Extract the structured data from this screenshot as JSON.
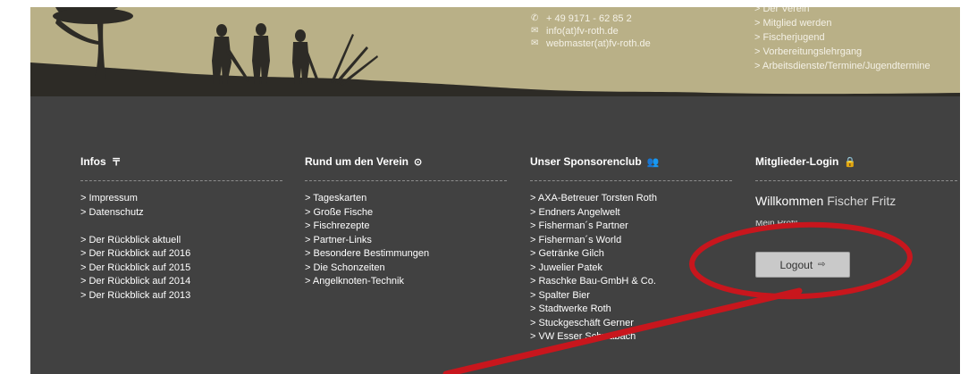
{
  "contact": {
    "phone": "+ 49 9171 - 62 85 2",
    "email1": "info(at)fv-roth.de",
    "email2": "webmaster(at)fv-roth.de"
  },
  "top_links": [
    "> Der Verein",
    "> Mitglied werden",
    "> Fischerjugend",
    "> Vorbereitungslehrgang",
    "> Arbeitsdienste/Termine/Jugendtermine"
  ],
  "columns": {
    "infos": {
      "title": "Infos",
      "items": [
        "> Impressum",
        "> Datenschutz",
        "",
        "> Der Rückblick aktuell",
        "> Der Rückblick auf 2016",
        "> Der Rückblick auf 2015",
        "> Der Rückblick auf 2014",
        "> Der Rückblick auf 2013"
      ]
    },
    "verein": {
      "title": "Rund um den Verein",
      "items": [
        "> Tageskarten",
        "> Große Fische",
        "> Fischrezepte",
        "> Partner-Links",
        "> Besondere Bestimmungen",
        "> Die Schonzeiten",
        "> Angelknoten-Technik"
      ]
    },
    "sponsoren": {
      "title": "Unser Sponsorenclub",
      "items": [
        "> AXA-Betreuer Torsten Roth",
        "> Endners Angelwelt",
        "> Fisherman´s Partner",
        "> Fisherman´s World",
        "> Getränke Gilch",
        "> Juwelier Patek",
        "> Raschke Bau-GmbH & Co.",
        "> Spalter Bier",
        "> Stadtwerke Roth",
        "> Stuckgeschäft Gerner",
        "> VW Esser Schwabach"
      ]
    },
    "login": {
      "title": "Mitglieder-Login",
      "welcome": "Willkommen",
      "user": "Fischer Fritz",
      "profile": "Mein Profil",
      "logout": "Logout"
    }
  },
  "icons": {
    "phone": "phone-icon",
    "mail": "mail-icon",
    "infos": "sign-icon",
    "verein": "target-icon",
    "sponsoren": "users-icon",
    "login": "lock-icon",
    "logout": "sign-out-icon"
  },
  "colors": {
    "banner": "#b9b087",
    "footer": "#414141",
    "annotation": "#c8161d"
  }
}
